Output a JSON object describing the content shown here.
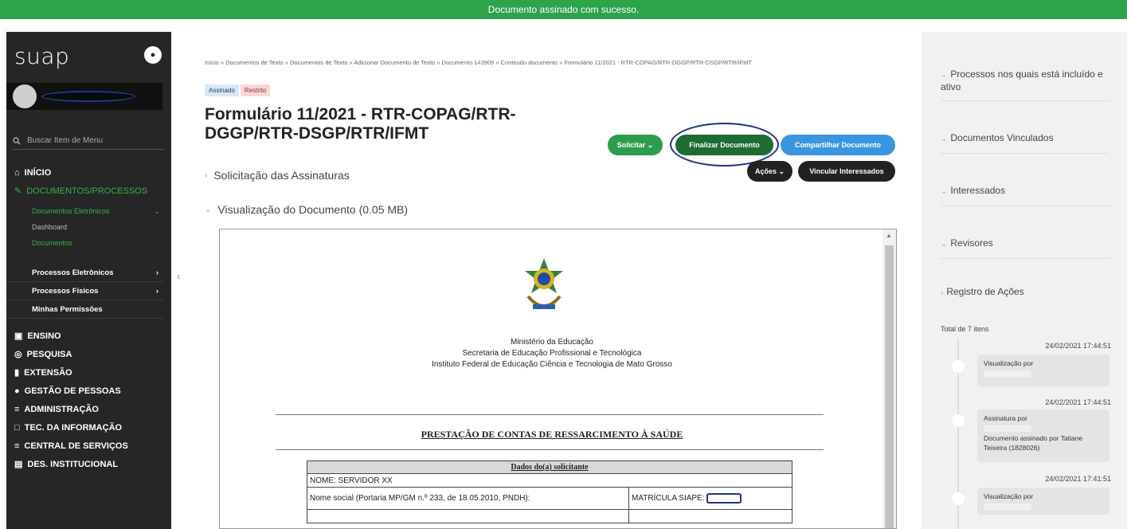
{
  "banner": {
    "message": "Documento assinado com sucesso."
  },
  "sidebar": {
    "logo": "suap",
    "search_placeholder": "Buscar Item de Menu",
    "menu": [
      {
        "label": "INÍCIO",
        "icon": "home-icon"
      },
      {
        "label": "DOCUMENTOS/PROCESSOS",
        "icon": "documents-icon"
      },
      {
        "label": "ENSINO",
        "icon": "teaching-icon"
      },
      {
        "label": "PESQUISA",
        "icon": "globe-icon"
      },
      {
        "label": "EXTENSÃO",
        "icon": "chart-icon"
      },
      {
        "label": "GESTÃO DE PESSOAS",
        "icon": "people-icon"
      },
      {
        "label": "ADMINISTRAÇÃO",
        "icon": "list-icon"
      },
      {
        "label": "TEC. DA INFORMAÇÃO",
        "icon": "monitor-icon"
      },
      {
        "label": "CENTRAL DE SERVIÇOS",
        "icon": "list-icon"
      },
      {
        "label": "DES. INSTITUCIONAL",
        "icon": "chart-line-icon"
      }
    ],
    "submenu": {
      "eletronicos": "Documentos Eletrônicos",
      "dashboard": "Dashboard",
      "documentos": "Documentos",
      "processos_eletronicos": "Processos Eletrônicos",
      "processos_fisicos": "Processos Físicos",
      "permissoes": "Minhas Permissões"
    }
  },
  "breadcrumb": "Início » Documentos de Texto » Documentos de Texto » Adicionar Documento de Texto » Documento 143909 » Conteudo documento » Formulário 11/2021 - RTR-COPAG/RTR-DGGP/RTR-DSGP/RTR/IFMT",
  "badges": {
    "assinado": "Assinado",
    "restrito": "Restrito"
  },
  "title": "Formulário 11/2021 - RTR-COPAG/RTR-DGGP/RTR-DSGP/RTR/IFMT",
  "buttons": {
    "solicitar": "Solicitar ⌄",
    "finalizar": "Finalizar Documento",
    "compartilhar": "Compartilhar Documento",
    "acoes": "Ações ⌄",
    "vincular": "Vincular Interessados"
  },
  "sections": {
    "solicitacao": "Solicitação das Assinaturas",
    "visualizacao": "Visualização do Documento (0.05 MB)"
  },
  "document": {
    "org_line1": "Ministério da Educação",
    "org_line2": "Secretaria de Educação Profissional e Tecnológica",
    "org_line3": "Instituto Federal de Educação Ciência e Tecnologia de Mato Grosso",
    "heading": "PRESTAÇÃO DE CONTAS DE RESSARCIMENTO À SAÚDE",
    "table_header": "Dados do(a) solicitante",
    "nome": "NOME: SERVIDOR XX",
    "nome_social": "Nome social (Portaria MP/GM n.º 233, de 18.05.2010, PNDH):",
    "matricula": "MATRÍCULA SIAPE:"
  },
  "right": {
    "processos": "Processos nos quais está incluído e ativo",
    "vinculados": "Documentos Vinculados",
    "interessados": "Interessados",
    "revisores": "Revisores",
    "registro": "Registro de Ações",
    "total": "Total de 7 itens",
    "timeline": [
      {
        "date": "24/02/2021 17:44:51",
        "title": "Visualização por",
        "detail": ""
      },
      {
        "date": "24/02/2021 17:44:51",
        "title": "Assinatura por",
        "detail": "Documento assinado por Tatiane Teixeira (1828026)"
      },
      {
        "date": "24/02/2021 17:41:51",
        "title": "Visualização por",
        "detail": ""
      }
    ]
  }
}
